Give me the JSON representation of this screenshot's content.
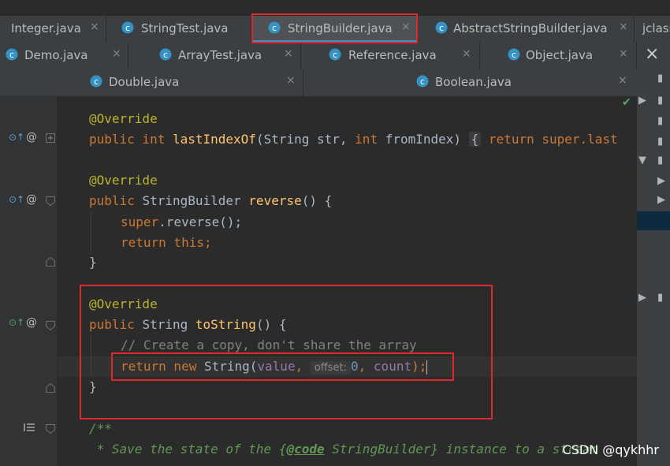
{
  "tabs_row1": [
    {
      "label": "Integer.java"
    },
    {
      "label": "StringTest.java"
    },
    {
      "label": "StringBuilder.java"
    },
    {
      "label": "AbstractStringBuilder.java"
    },
    {
      "label": "jclass"
    }
  ],
  "tabs_row2": [
    {
      "label": "Demo.java"
    },
    {
      "label": "ArrayTest.java"
    },
    {
      "label": "Reference.java"
    },
    {
      "label": "Object.java"
    }
  ],
  "tabs_row3": [
    {
      "label": "Double.java"
    },
    {
      "label": "Boolean.java"
    }
  ],
  "close_glyph": "×",
  "watermark": "CSDN @qykhhr",
  "code": {
    "l1_ann": "@Override",
    "l2_kw": "public int ",
    "l2_fn": "lastIndexOf",
    "l2_p1": "(String str, ",
    "l2_kw2": "int ",
    "l2_p2": "fromIndex) ",
    "l2_fold": "{",
    "l2_kw3": " return ",
    "l2_rest": "super.last",
    "l3_ann": "@Override",
    "l4_kw": "public ",
    "l4_type": "StringBuilder ",
    "l4_fn": "reverse",
    "l4_rest": "() {",
    "l5_kw": "super",
    "l5_rest": ".reverse();",
    "l6_kw": "return this;",
    "l7": "}",
    "l8_ann": "@Override",
    "l9_kw": "public ",
    "l9_type": "String ",
    "l9_fn": "toString",
    "l9_rest": "() {",
    "l10_cmt": "// Create a copy, don't share the array",
    "l11_kw": "return new ",
    "l11_type": "String(",
    "l11_fld": "value",
    "l11_comma": ", ",
    "l11_hint": "offset:",
    "l11_num": "0",
    "l11_c2": ", ",
    "l11_fld2": "count",
    "l11_end": ");",
    "l12": "}",
    "l13_doc": "/**",
    "l14_doc1": " * Save the state of the ",
    "l14_tagopen": "{",
    "l14_tag": "@code",
    "l14_doc2": " StringBuilder",
    "l14_tagclose": "}",
    "l14_doc3": " instance to a stream"
  },
  "gutter_marks": {
    "override": "@",
    "impl": "⊙↑"
  },
  "colors": {
    "accent": "#4a88c7",
    "highlight": "#e0262e",
    "check": "#59a869"
  }
}
